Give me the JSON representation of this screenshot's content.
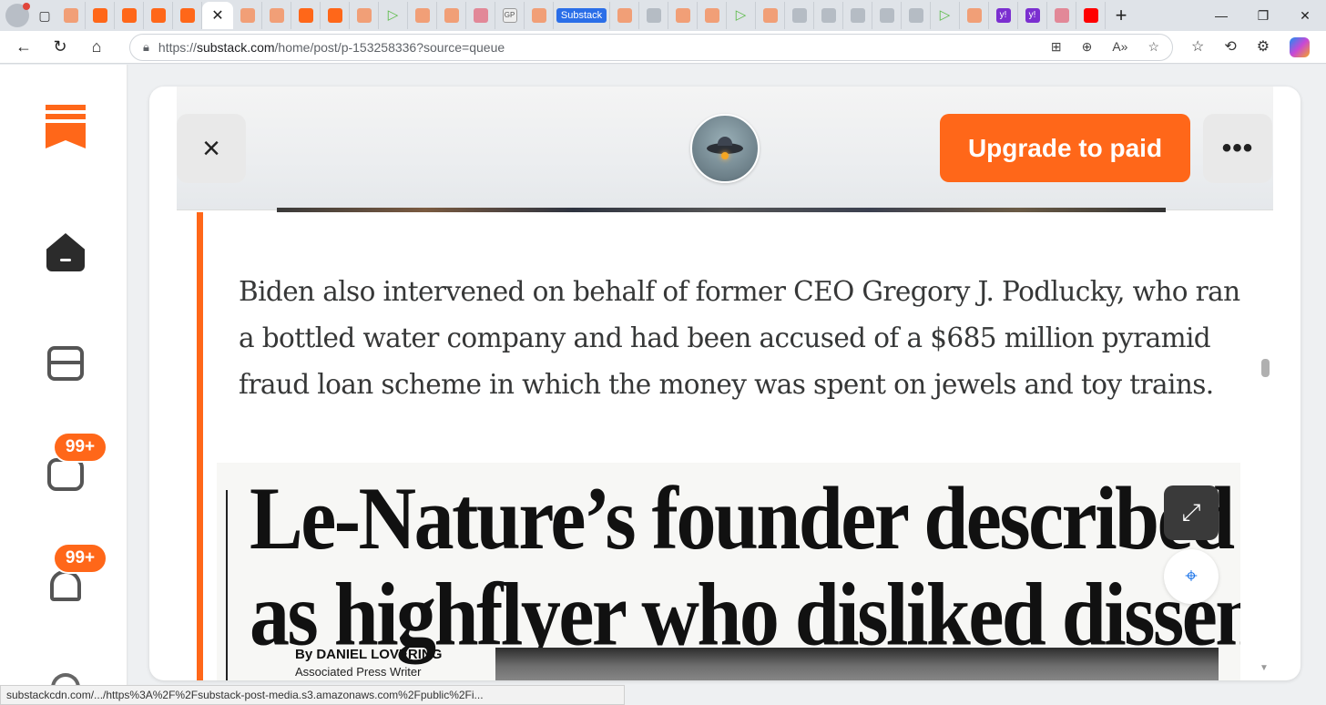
{
  "browser": {
    "active_tab_label": "Substack",
    "url_domain": "substack.com",
    "url_prefix": "https://",
    "url_path": "/home/post/p-153258336?source=queue",
    "status_url": "substackcdn.com/.../https%3A%2F%2Fsubstack-post-media.s3.amazonaws.com%2Fpublic%2Fi..."
  },
  "sidebar": {
    "chat_badge": "99+",
    "notifications_badge": "99+"
  },
  "header": {
    "close_icon": "×",
    "upgrade_label": "Upgrade to paid",
    "more_label": "•••"
  },
  "article": {
    "paragraph": "Biden also intervened on behalf of former CEO Gregory J. Podlucky, who ran a bottled water company and had been accused of a $685 million pyramid fraud loan scheme in which the money was spent on jewels and toy trains."
  },
  "clipping": {
    "headline_line1": "Le-Nature’s founder described",
    "headline_line2": "as highflyer who disliked dissent",
    "byline": "By DANIEL LOVERING",
    "byline_role": "Associated Press Writer"
  },
  "colors": {
    "accent": "#ff6719"
  }
}
